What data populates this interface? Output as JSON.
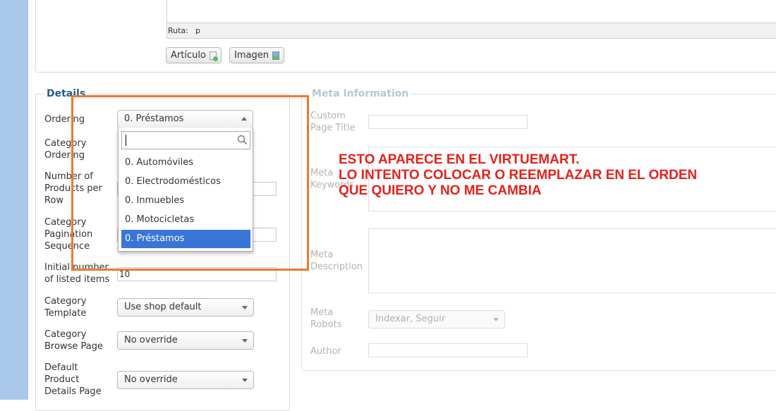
{
  "editor": {
    "path_label": "Ruta:",
    "path_value": "p",
    "buttons": [
      {
        "label": "Artículo",
        "icon": "article-icon"
      },
      {
        "label": "Imagen",
        "icon": "image-icon"
      }
    ]
  },
  "details": {
    "legend": "Details",
    "ordering": {
      "label": "Ordering",
      "value": "0. Préstamos"
    },
    "category_ordering": {
      "label_l1": "Category",
      "label_l2": "Ordering"
    },
    "products_per_row": {
      "label_l1": "Number of",
      "label_l2": "Products per",
      "label_l3": "Row"
    },
    "pagination_sequence": {
      "label_l1": "Category",
      "label_l2": "Pagination",
      "label_l3": "Sequence"
    },
    "initial_number": {
      "label_l1": "Initial number",
      "label_l2": "of listed items",
      "value": "10"
    },
    "category_template": {
      "label_l1": "Category",
      "label_l2": "Template",
      "value": "Use shop default"
    },
    "browse_page": {
      "label_l1": "Category",
      "label_l2": "Browse Page",
      "value": "No override"
    },
    "product_details_page": {
      "label_l1": "Default",
      "label_l2": "Product",
      "label_l3": "Details Page",
      "value": "No override"
    }
  },
  "dropdown": {
    "search_value": "",
    "options": [
      {
        "label": "0. Automóviles"
      },
      {
        "label": "0. Electrodomésticos"
      },
      {
        "label": "0. Inmuebles"
      },
      {
        "label": "0. Motocicletas"
      },
      {
        "label": "0. Préstamos"
      }
    ],
    "selected_label": "0. Préstamos"
  },
  "meta": {
    "legend": "Meta Information",
    "custom_page_title": {
      "label_l1": "Custom",
      "label_l2": "Page Title"
    },
    "keywords": {
      "label_l1": "Meta",
      "label_l2": "Keywords"
    },
    "description": {
      "label_l1": "Meta",
      "label_l2": "Description"
    },
    "robots": {
      "label_l1": "Meta",
      "label_l2": "Robots",
      "value": "Indexar, Seguir"
    },
    "author": {
      "label": "Author"
    }
  },
  "annotation": {
    "line1": "ESTO APARECE EN EL VIRTUEMART.",
    "line2": "LO INTENTO COLOCAR O REEMPLAZAR EN EL ORDEN",
    "line3": "QUE QUIERO Y NO ME CAMBIA",
    "color": "#e3221b",
    "box_color": "#ec7a2e"
  }
}
